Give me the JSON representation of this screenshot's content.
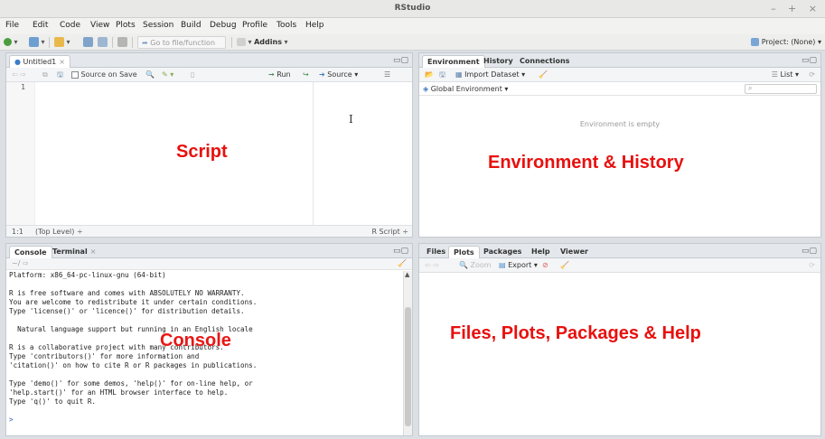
{
  "window": {
    "title": "RStudio",
    "controls": "– + ×"
  },
  "menu": [
    "File",
    "Edit",
    "Code",
    "View",
    "Plots",
    "Session",
    "Build",
    "Debug",
    "Profile",
    "Tools",
    "Help"
  ],
  "toolbar": {
    "goto_placeholder": "Go to file/function",
    "addins": "Addins",
    "project": "Project: (None)"
  },
  "source": {
    "tab": "Untitled1",
    "source_on_save": "Source on Save",
    "run": "Run",
    "source": "Source",
    "line_number": "1",
    "status_pos": "1:1",
    "status_level": "(Top Level) ÷",
    "status_type": "R Script ÷",
    "label": "Script"
  },
  "environment": {
    "tabs": [
      "Environment",
      "History",
      "Connections"
    ],
    "import_dataset": "Import Dataset",
    "list": "List",
    "global_env": "Global Environment",
    "empty": "Environment is empty",
    "label": "Environment & History"
  },
  "console": {
    "tabs": [
      "Console",
      "Terminal"
    ],
    "path": "~/",
    "lines": [
      "Platform: x86_64-pc-linux-gnu (64-bit)",
      "",
      "R is free software and comes with ABSOLUTELY NO WARRANTY.",
      "You are welcome to redistribute it under certain conditions.",
      "Type 'license()' or 'licence()' for distribution details.",
      "",
      "  Natural language support but running in an English locale",
      "",
      "R is a collaborative project with many contributors.",
      "Type 'contributors()' for more information and",
      "'citation()' on how to cite R or R packages in publications.",
      "",
      "Type 'demo()' for some demos, 'help()' for on-line help, or",
      "'help.start()' for an HTML browser interface to help.",
      "Type 'q()' to quit R.",
      "",
      "> "
    ],
    "label": "Console"
  },
  "files": {
    "tabs": [
      "Files",
      "Plots",
      "Packages",
      "Help",
      "Viewer"
    ],
    "zoom": "Zoom",
    "export": "Export",
    "label": "Files, Plots, Packages & Help"
  }
}
